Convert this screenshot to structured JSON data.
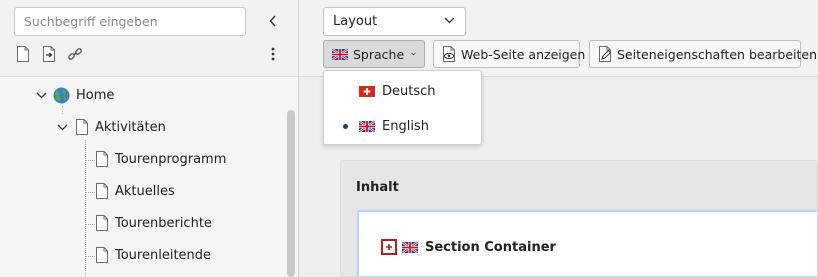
{
  "sidebar": {
    "search": {
      "placeholder": "Suchbegriff eingeben",
      "value": ""
    },
    "toolbar_icons": [
      "new-page-icon",
      "page-action-icon",
      "link-icon"
    ],
    "tree": [
      {
        "label": "Home",
        "level": 0,
        "expanded": true,
        "icon": "globe-icon"
      },
      {
        "label": "Aktivitäten",
        "level": 1,
        "expanded": true,
        "icon": "page-icon"
      },
      {
        "label": "Tourenprogramm",
        "level": 2,
        "icon": "page-icon"
      },
      {
        "label": "Aktuelles",
        "level": 2,
        "icon": "page-icon"
      },
      {
        "label": "Tourenberichte",
        "level": 2,
        "icon": "page-icon"
      },
      {
        "label": "Tourenleitende",
        "level": 2,
        "icon": "page-icon"
      }
    ]
  },
  "toolbar": {
    "layout_select": "Layout",
    "language_button": "Sprache",
    "view_button": "Web-Seite anzeigen",
    "edit_props_button": "Seiteneigenschaften bearbeiten"
  },
  "language_menu": {
    "items": [
      {
        "label": "Deutsch",
        "flag": "swiss-flag-icon",
        "selected": false
      },
      {
        "label": "English",
        "flag": "uk-flag-icon",
        "selected": true
      }
    ]
  },
  "content": {
    "panel_title": "Inhalt",
    "section_title": "Section Container"
  },
  "colors": {
    "accent_border": "#b9d7ef",
    "toggle_border": "#b91c1c",
    "selected_dot": "#1a3a6e"
  }
}
